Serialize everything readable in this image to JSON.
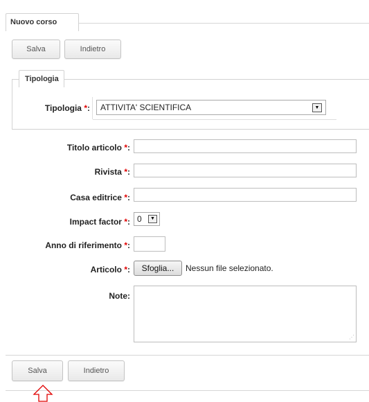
{
  "header": {
    "title": "Nuovo corso"
  },
  "toolbar_top": {
    "save_label": "Salva",
    "back_label": "Indietro"
  },
  "tipologia_section": {
    "legend": "Tipologia",
    "field_label": "Tipologia",
    "selected_value": "ATTIVITA' SCIENTIFICA"
  },
  "form": {
    "required_marker": "*",
    "colon": ":",
    "titolo_label": "Titolo articolo",
    "rivista_label": "Rivista",
    "casa_label": "Casa editrice",
    "impact_label": "Impact factor",
    "impact_value": "0",
    "anno_label": "Anno di riferimento",
    "articolo_label": "Articolo",
    "browse_label": "Sfoglia...",
    "no_file_text": "Nessun file selezionato.",
    "note_label": "Note:"
  },
  "toolbar_bottom": {
    "save_label": "Salva",
    "back_label": "Indietro"
  },
  "icons": {
    "cursor": "arrow-cursor-icon",
    "resize": "resize-grip-icon",
    "dropdown": "dropdown-arrow-icon"
  },
  "colors": {
    "required": "#e00000",
    "pointer": "#e00000"
  }
}
